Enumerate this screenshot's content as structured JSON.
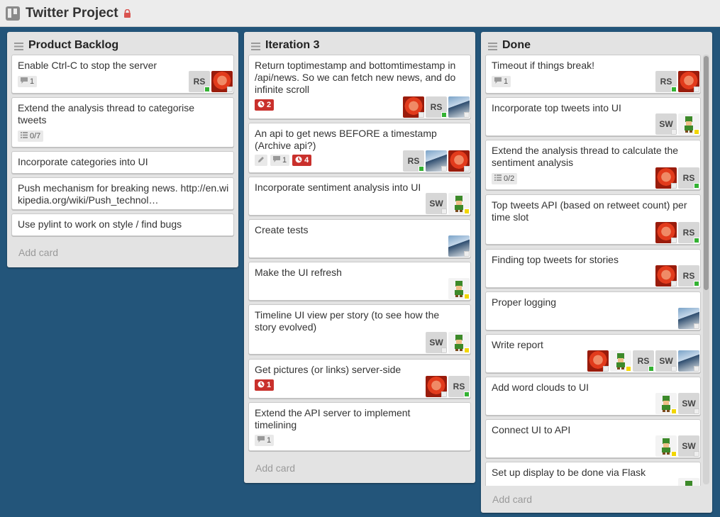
{
  "board": {
    "title": "Twitter Project"
  },
  "colors": {
    "background": "#23557a",
    "member_green": "#34b233",
    "member_yellow": "#f2d600",
    "badge_red": "#c9302c"
  },
  "lists": [
    {
      "title": "Product Backlog",
      "add_card": "Add card",
      "cards": [
        {
          "title": "Enable Ctrl-C to stop the server",
          "comments": "1",
          "members": [
            "RS",
            "red-avatar"
          ]
        },
        {
          "title": "Extend the analysis thread to categorise tweets",
          "checklist": "0/7"
        },
        {
          "title": "Incorporate categories into UI"
        },
        {
          "title": "Push mechanism for breaking news. http://en.wikipedia.org/wiki/Push_technol…"
        },
        {
          "title": "Use pylint to work on style / find bugs"
        }
      ]
    },
    {
      "title": "Iteration 3",
      "add_card": "Add card",
      "cards": [
        {
          "title": "Return toptimestamp and bottomtimestamp in /api/news. So we can fetch new news, and do infinite scroll",
          "due": "2",
          "members": [
            "red-avatar",
            "RS",
            "photo-avatar"
          ]
        },
        {
          "title": "An api to get news BEFORE a timestamp (Archive api?)",
          "comments": "1",
          "due": "4",
          "members": [
            "RS",
            "photo-avatar",
            "red-avatar"
          ]
        },
        {
          "title": "Incorporate sentiment analysis into UI",
          "members": [
            "SW",
            "pixel-avatar"
          ]
        },
        {
          "title": "Create tests",
          "members": [
            "photo-avatar"
          ]
        },
        {
          "title": "Make the UI refresh",
          "members": [
            "pixel-avatar"
          ]
        },
        {
          "title": "Timeline UI view per story (to see how the story evolved)",
          "members": [
            "SW",
            "pixel-avatar"
          ]
        },
        {
          "title": "Get pictures (or links) server-side",
          "due": "1",
          "members": [
            "red-avatar",
            "RS"
          ]
        },
        {
          "title": "Extend the API server to implement timelining",
          "comments": "1"
        }
      ]
    },
    {
      "title": "Done",
      "add_card": "Add card",
      "cards": [
        {
          "title": "Timeout if things break!",
          "comments": "1",
          "members": [
            "RS",
            "red-avatar"
          ]
        },
        {
          "title": "Incorporate top tweets into UI",
          "members": [
            "SW",
            "pixel-avatar"
          ]
        },
        {
          "title": "Extend the analysis thread to calculate the sentiment analysis",
          "checklist": "0/2",
          "members": [
            "red-avatar",
            "RS"
          ]
        },
        {
          "title": "Top tweets API (based on retweet count) per time slot",
          "members": [
            "red-avatar",
            "RS"
          ]
        },
        {
          "title": "Finding top tweets for stories",
          "members": [
            "red-avatar",
            "RS"
          ]
        },
        {
          "title": "Proper logging",
          "members": [
            "photo-avatar"
          ]
        },
        {
          "title": "Write report",
          "members": [
            "red-avatar",
            "pixel-avatar",
            "RS",
            "SW",
            "photo-avatar"
          ]
        },
        {
          "title": "Add word clouds to UI",
          "members": [
            "pixel-avatar",
            "SW"
          ]
        },
        {
          "title": "Connect UI to API",
          "members": [
            "pixel-avatar",
            "SW"
          ]
        },
        {
          "title": "Set up display to be done via Flask",
          "members": [
            "pixel-avatar"
          ]
        }
      ]
    }
  ]
}
